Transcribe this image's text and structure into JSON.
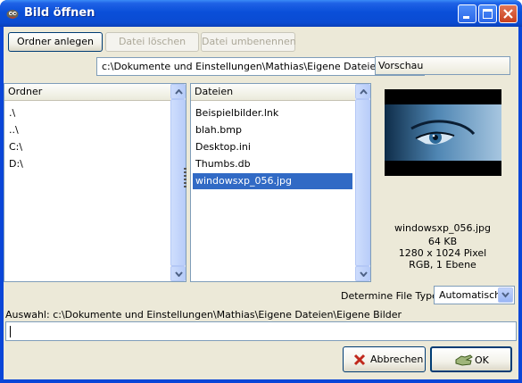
{
  "window": {
    "title": "Bild öffnen"
  },
  "toolbar": {
    "new_folder": "Ordner anlegen",
    "delete_file": "Datei löschen",
    "rename_file": "Datei umbenennen"
  },
  "path_combo": {
    "value": "c:\\Dokumente und Einstellungen\\Mathias\\Eigene Dateien\\Eigene Bilder"
  },
  "folders": {
    "header": "Ordner",
    "items": [
      ".\\",
      "..\\",
      "C:\\",
      "D:\\"
    ]
  },
  "files": {
    "header": "Dateien",
    "items": [
      "Beispielbilder.lnk",
      "blah.bmp",
      "Desktop.ini",
      "Thumbs.db",
      "windowsxp_056.jpg"
    ],
    "selected_index": 4
  },
  "preview": {
    "header": "Vorschau",
    "filename": "windowsxp_056.jpg",
    "size": "64 KB",
    "dimensions": "1280 x 1024 Pixel",
    "mode": "RGB, 1 Ebene"
  },
  "file_type": {
    "label": "Determine File Type:",
    "value": "Automatisch"
  },
  "selection": {
    "label": "Auswahl: c:\\Dokumente und Einstellungen\\Mathias\\Eigene Dateien\\Eigene Bilder",
    "value": ""
  },
  "buttons": {
    "cancel": "Abbrechen",
    "ok": "OK"
  },
  "colors": {
    "titlebar": "#0a4fd9",
    "selection": "#316ac5",
    "dialog_bg": "#ece9d8"
  }
}
